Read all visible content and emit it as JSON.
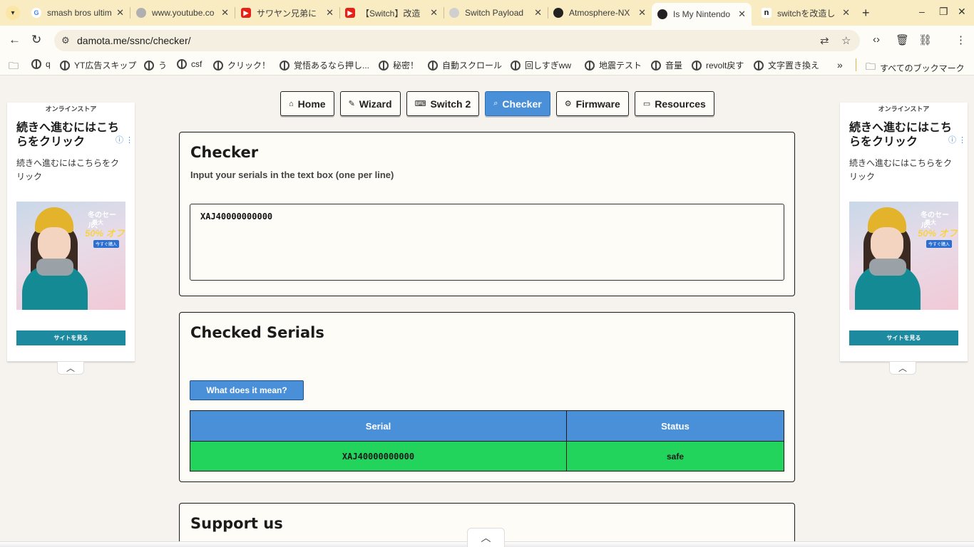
{
  "tabs": [
    {
      "title": "smash bros ultim",
      "favicon": "G",
      "color": "#4285f4"
    },
    {
      "title": "www.youtube.co",
      "favicon": "",
      "color": "#9e9e9e"
    },
    {
      "title": "サワヤン兄弟に",
      "favicon": "▶",
      "color": "#e62117"
    },
    {
      "title": "【Switch】改造",
      "favicon": "▶",
      "color": "#e62117"
    },
    {
      "title": "Switch Payload",
      "favicon": "",
      "color": "#9e9e9e"
    },
    {
      "title": "Atmosphere-NX",
      "favicon": "",
      "color": "#222222"
    },
    {
      "title": "Is My Nintendo",
      "favicon": "",
      "color": "#222222"
    },
    {
      "title": "switchを改造し",
      "favicon": "n",
      "color": "#111111"
    }
  ],
  "url": "damota.me/ssnc/checker/",
  "bookmarks": [
    "q",
    "YT広告スキップ",
    "う",
    "csf",
    "クリック！",
    "覚悟あるなら押し...",
    "秘密！",
    "自動スクロール",
    "回しすぎww",
    "地震テスト",
    "音量",
    "revolt戻す",
    "文字置き換え"
  ],
  "bookmarks_all": "すべてのブックマーク",
  "nav": [
    "Home",
    "Wizard",
    "Switch 2",
    "Checker",
    "Firmware",
    "Resources"
  ],
  "checker": {
    "title": "Checker",
    "subtitle": "Input your serials in the text box (one per line)",
    "input_value": "XAJ40000000000"
  },
  "checked": {
    "title": "Checked Serials",
    "meaning_button": "What does it mean?",
    "headers": [
      "Serial",
      "Status"
    ],
    "rows": [
      {
        "serial": "XAJ40000000000",
        "status": "safe"
      }
    ]
  },
  "support": {
    "title": "Support us"
  },
  "ad": {
    "store": "オンラインストア",
    "headline": "続きへ進むにはこちらをクリック",
    "body": "続きへ進むにはこちらをクリック",
    "sale_1": "冬のセール、",
    "sale_2": "最大",
    "sale_3": "50% オフ",
    "sale_4": "今すぐ購入",
    "cta": "サイトを見る"
  },
  "colors": {
    "accent": "#4a90d9",
    "safe": "#22d35c"
  }
}
